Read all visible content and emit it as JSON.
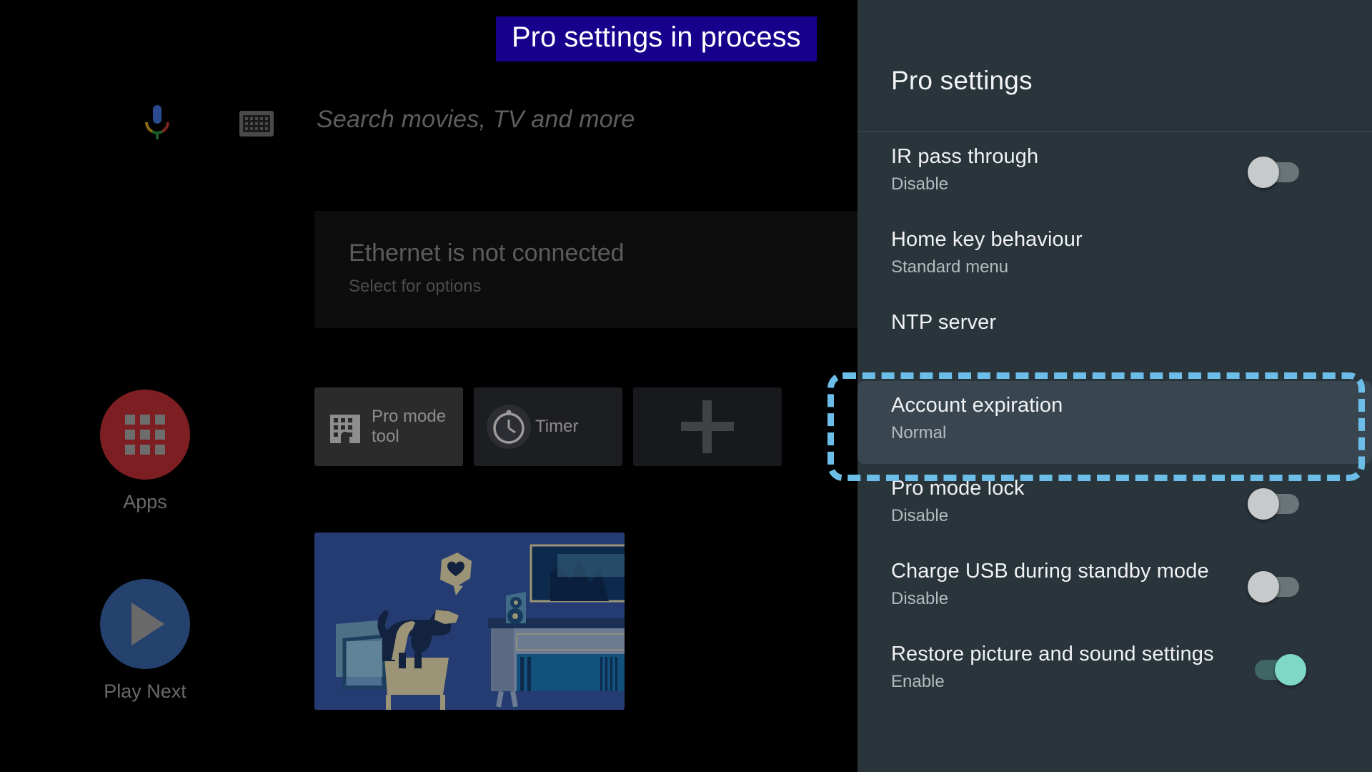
{
  "toast": {
    "message": "Pro settings in process",
    "bg_color": "#16008C",
    "text_color": "#FFFFFF"
  },
  "home": {
    "search": {
      "placeholder": "Search movies, TV and more",
      "mic_icon": "google-mic-icon",
      "keyboard_icon": "keyboard-icon"
    },
    "ethernet_card": {
      "title": "Ethernet is not connected",
      "subtitle": "Select for options"
    },
    "shortcuts": [
      {
        "label": "Apps",
        "icon": "apps-grid-icon",
        "color": "#7D1F22"
      },
      {
        "label": "Play Next",
        "icon": "play-icon",
        "color": "#25416E"
      }
    ],
    "app_tiles": [
      {
        "label": "Pro mode tool",
        "icon": "building-icon"
      },
      {
        "label": "Timer",
        "icon": "clock-icon"
      },
      {
        "label": "",
        "icon": "plus-icon"
      }
    ],
    "illustration": {
      "name": "dog-watching-tv-illustration",
      "bg_color": "#253C72"
    }
  },
  "panel": {
    "title": "Pro settings",
    "bg_color": "#29343B",
    "focus_color": "#6CBEE8",
    "rows": [
      {
        "title": "IR pass through",
        "subtitle": "Disable",
        "control": "toggle",
        "state": "off",
        "focused": false
      },
      {
        "title": "Home key behaviour",
        "subtitle": "Standard menu",
        "control": "none",
        "state": "",
        "focused": false
      },
      {
        "title": "NTP server",
        "subtitle": "",
        "control": "none",
        "state": "",
        "focused": false
      },
      {
        "title": "Account expiration",
        "subtitle": "Normal",
        "control": "none",
        "state": "",
        "focused": true
      },
      {
        "title": "Pro mode lock",
        "subtitle": "Disable",
        "control": "toggle",
        "state": "off",
        "focused": false
      },
      {
        "title": "Charge USB during standby mode",
        "subtitle": "Disable",
        "control": "toggle",
        "state": "off",
        "focused": false
      },
      {
        "title": "Restore picture and sound settings",
        "subtitle": "Enable",
        "control": "toggle",
        "state": "on",
        "focused": false
      }
    ]
  }
}
